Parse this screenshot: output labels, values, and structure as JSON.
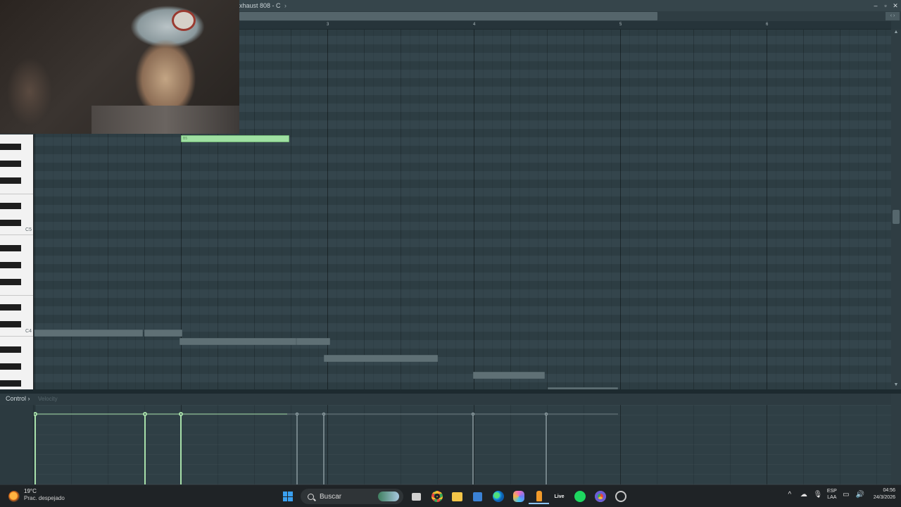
{
  "window": {
    "title": "xhaust 808 - C",
    "title_arrow": "›",
    "minimize": "–",
    "restore": "▫",
    "close": "✕"
  },
  "ruler": {
    "marks": [
      "3",
      "4",
      "5",
      "6"
    ]
  },
  "keyboard": {
    "labels": [
      "C5",
      "C4"
    ]
  },
  "note_label": "B5",
  "control": {
    "label": "Control",
    "chevron": "›",
    "sub": "Velocity"
  },
  "scrollbar": {
    "up": "▲",
    "down": "▼",
    "end_label": "‹ ›"
  },
  "taskbar": {
    "weather_temp": "19°C",
    "weather_desc": "Prac. despejado",
    "search_placeholder": "Buscar",
    "apps": [
      "widgets",
      "file-explorer",
      "chrome",
      "folder",
      "store",
      "edge",
      "copilot",
      "fl-studio",
      "ableton-live",
      "spotify",
      "chrome-profile",
      "davinci"
    ],
    "live_label": "Live",
    "lang_top": "ESP",
    "lang_bottom": "LAA",
    "time": "04:56",
    "date": "24/3/2026"
  }
}
